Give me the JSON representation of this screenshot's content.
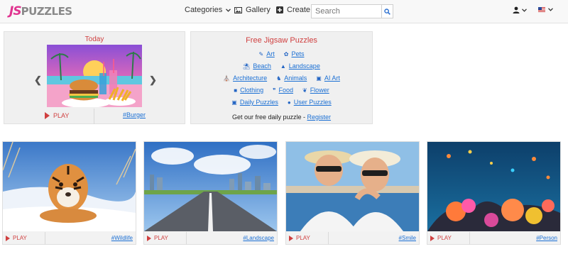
{
  "header": {
    "logo_js": "JS",
    "logo_puzzles": "PUZZLES",
    "nav": {
      "categories": "Categories",
      "gallery": "Gallery",
      "create": "Create"
    },
    "search": {
      "placeholder": "Search"
    }
  },
  "today": {
    "title": "Today",
    "play_label": "PLAY",
    "tag": "#Burger"
  },
  "free_puzzles": {
    "title": "Free Jigsaw Puzzles",
    "rows": [
      [
        {
          "label": "Art",
          "icon": "brush-icon"
        },
        {
          "label": "Pets",
          "icon": "paw-icon"
        }
      ],
      [
        {
          "label": "Beach",
          "icon": "beach-umbrella-icon"
        },
        {
          "label": "Landscape",
          "icon": "mountain-icon"
        }
      ],
      [
        {
          "label": "Architecture",
          "icon": "landmark-icon"
        },
        {
          "label": "Animals",
          "icon": "horse-icon"
        },
        {
          "label": "AI Art",
          "icon": "laptop-icon"
        }
      ],
      [
        {
          "label": "Clothing",
          "icon": "shirt-icon"
        },
        {
          "label": "Food",
          "icon": "utensils-icon"
        },
        {
          "label": "Flower",
          "icon": "leaf-icon"
        }
      ],
      [
        {
          "label": "Daily Puzzles",
          "icon": "image-icon"
        },
        {
          "label": "User Puzzles",
          "icon": "user-icon"
        }
      ]
    ],
    "register_text": "Get our free daily puzzle - ",
    "register_link": "Register"
  },
  "cards": [
    {
      "play": "PLAY",
      "tag": "#Wildlife"
    },
    {
      "play": "PLAY",
      "tag": "#Landscape"
    },
    {
      "play": "PLAY",
      "tag": "#Smile"
    },
    {
      "play": "PLAY",
      "tag": "#Person"
    }
  ],
  "colors": {
    "accent_red": "#d04040",
    "link_blue": "#1a6fd4",
    "logo_pink": "#e0338f"
  }
}
